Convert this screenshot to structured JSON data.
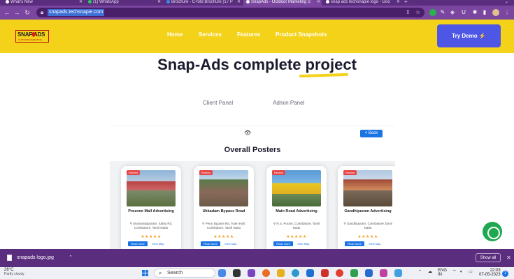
{
  "browser": {
    "tabs": [
      {
        "title": "What's New",
        "active": false
      },
      {
        "title": "(1) WhatsApp",
        "active": false
      },
      {
        "title": "Brochure - C-fold Brochure (17 P",
        "active": false
      },
      {
        "title": "SnapAds - Outdoor Marketing S",
        "active": true
      },
      {
        "title": "snap ads techsnapie logo - Goo",
        "active": false
      }
    ],
    "url": "snapads.techsnapie.com"
  },
  "site": {
    "logo_text": "SNAP ADS",
    "logo_tagline": "OUTDOOR MARKETING",
    "nav": [
      "Home",
      "Services",
      "Features",
      "Product Snapshots"
    ],
    "cta": "Try Demo ⚡"
  },
  "hero": {
    "title": "Snap-Ads complete project",
    "panel_tabs": [
      "Client Panel",
      "Admin Panel"
    ]
  },
  "preview": {
    "back_label": "< Back",
    "heading": "Overall Posters",
    "cards": [
      {
        "badge": "Rented",
        "title": "Prozone Mall Advertising",
        "address": "Sivanandapuram, Sathy Rd, Coimbatore, Tamil Nadu",
        "stars": "★★★★★",
        "read_more": "Read more",
        "view_map": "View Map"
      },
      {
        "badge": "Rented",
        "title": "Ukkadam Bypass Road",
        "address": "Perur Bypass Rd, Town Hall, Coimbatore, Tamil Nadu",
        "stars": "★★★★★",
        "read_more": "Read more",
        "view_map": "View Map"
      },
      {
        "badge": "Rented",
        "title": "Main Road Advertising",
        "address": "R.S. Puram, Coimbatore, Tamil Nadu",
        "stars": "★★★★★",
        "read_more": "Read more",
        "view_map": "View Map"
      },
      {
        "badge": "Rented",
        "title": "Gandhipuram Advertising",
        "address": "Gandhipuram, Coimbatore,Tamil Nadu",
        "stars": "★★★★★",
        "read_more": "Read more",
        "view_map": "View Map"
      }
    ]
  },
  "downloads": {
    "file": "snapads logo.jpg",
    "show_all": "Show all"
  },
  "taskbar": {
    "temp": "26°C",
    "weather": "Partly cloudy",
    "search": "Search",
    "lang": "ENG",
    "region": "IN",
    "time": "22:03",
    "date": "07-05-2023",
    "notifications": "1"
  },
  "colors": {
    "browser_frame": "#7a46a0",
    "header_yellow": "#f5d21a",
    "cta_blue": "#4e56e6",
    "badge_red": "#e64545",
    "chat_green": "#1fa84f"
  }
}
